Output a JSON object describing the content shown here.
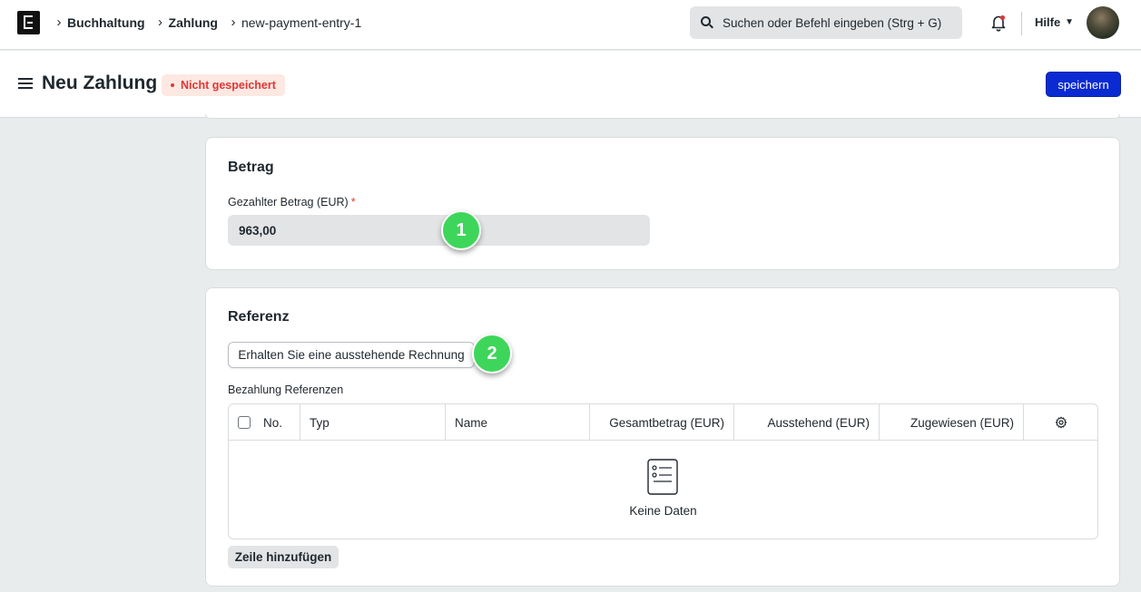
{
  "navbar": {
    "breadcrumbs": [
      "Buchhaltung",
      "Zahlung",
      "new-payment-entry-1"
    ],
    "search_placeholder": "Suchen oder Befehl eingeben (Strg + G)",
    "help_label": "Hilfe"
  },
  "header": {
    "title": "Neu Zahlung",
    "status_badge": "Nicht gespeichert",
    "save_label": "speichern"
  },
  "betrag": {
    "title": "Betrag",
    "field_label": "Gezahlter Betrag (EUR)",
    "required_mark": "*",
    "value": "963,00"
  },
  "referenz": {
    "title": "Referenz",
    "fetch_button": "Erhalten Sie eine ausstehende Rechnung",
    "table_label": "Bezahlung Referenzen",
    "columns": [
      "No.",
      "Typ",
      "Name",
      "Gesamtbetrag (EUR)",
      "Ausstehend (EUR)",
      "Zugewiesen (EUR)"
    ],
    "empty_text": "Keine Daten",
    "add_row_button": "Zeile hinzufügen"
  },
  "markers": [
    "1",
    "2"
  ],
  "colors": {
    "primary_button": "#0a2bd1",
    "badge_text": "#e03636",
    "badge_bg": "#fde8e2",
    "marker": "#3dd65a"
  },
  "icons": [
    "app-logo-icon",
    "chevron-right-icon",
    "search-icon",
    "bell-icon",
    "chevron-down-icon",
    "hamburger-icon",
    "gear-icon",
    "empty-list-icon"
  ]
}
